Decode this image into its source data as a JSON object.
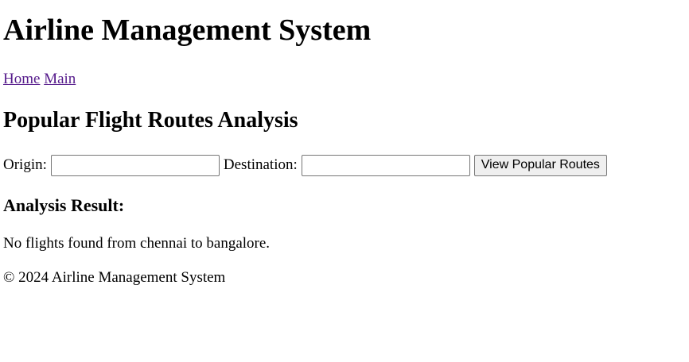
{
  "header": {
    "title": "Airline Management System"
  },
  "nav": {
    "links": [
      {
        "label": "Home"
      },
      {
        "label": "Main"
      }
    ]
  },
  "section": {
    "heading": "Popular Flight Routes Analysis"
  },
  "form": {
    "origin_label": "Origin:",
    "origin_value": "",
    "destination_label": "Destination:",
    "destination_value": "",
    "submit_label": "View Popular Routes"
  },
  "result": {
    "heading": "Analysis Result:",
    "message": "No flights found from chennai to bangalore."
  },
  "footer": {
    "text": "© 2024 Airline Management System"
  },
  "colors": {
    "link_visited": "#551a8b",
    "text": "#000000",
    "button_bg": "#efefef"
  }
}
